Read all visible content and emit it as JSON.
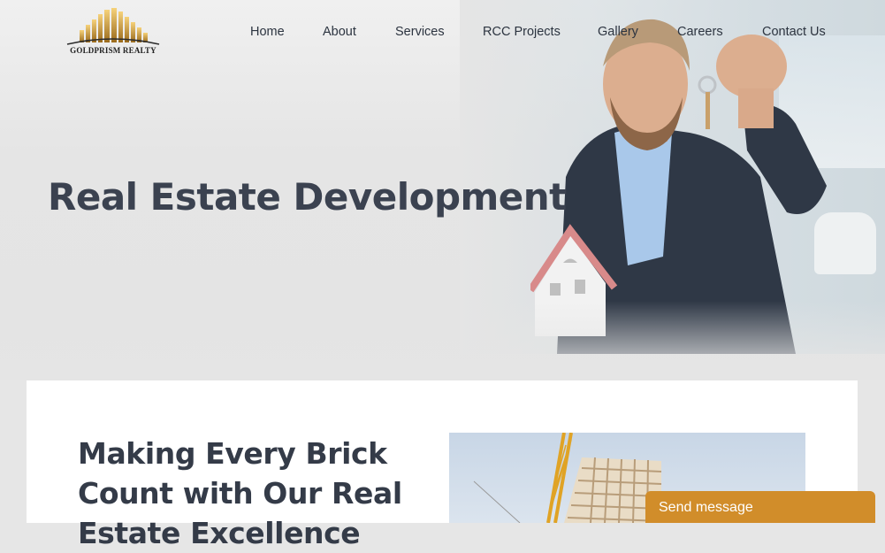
{
  "brand": {
    "name": "GOLDPRISM REALTY"
  },
  "nav": {
    "items": [
      {
        "label": "Home"
      },
      {
        "label": "About"
      },
      {
        "label": "Services"
      },
      {
        "label": "RCC Projects"
      },
      {
        "label": "Gallery"
      },
      {
        "label": "Careers"
      },
      {
        "label": "Contact Us"
      }
    ]
  },
  "hero": {
    "title": "Real Estate Development"
  },
  "intro": {
    "heading": "Making Every Brick Count with Our Real Estate Excellence"
  },
  "chat": {
    "label": "Send message"
  },
  "colors": {
    "accent": "#d18d2a",
    "heading": "#3b4250",
    "gold": "#c9962e"
  },
  "icons": [
    "logo-skyline-icon"
  ]
}
